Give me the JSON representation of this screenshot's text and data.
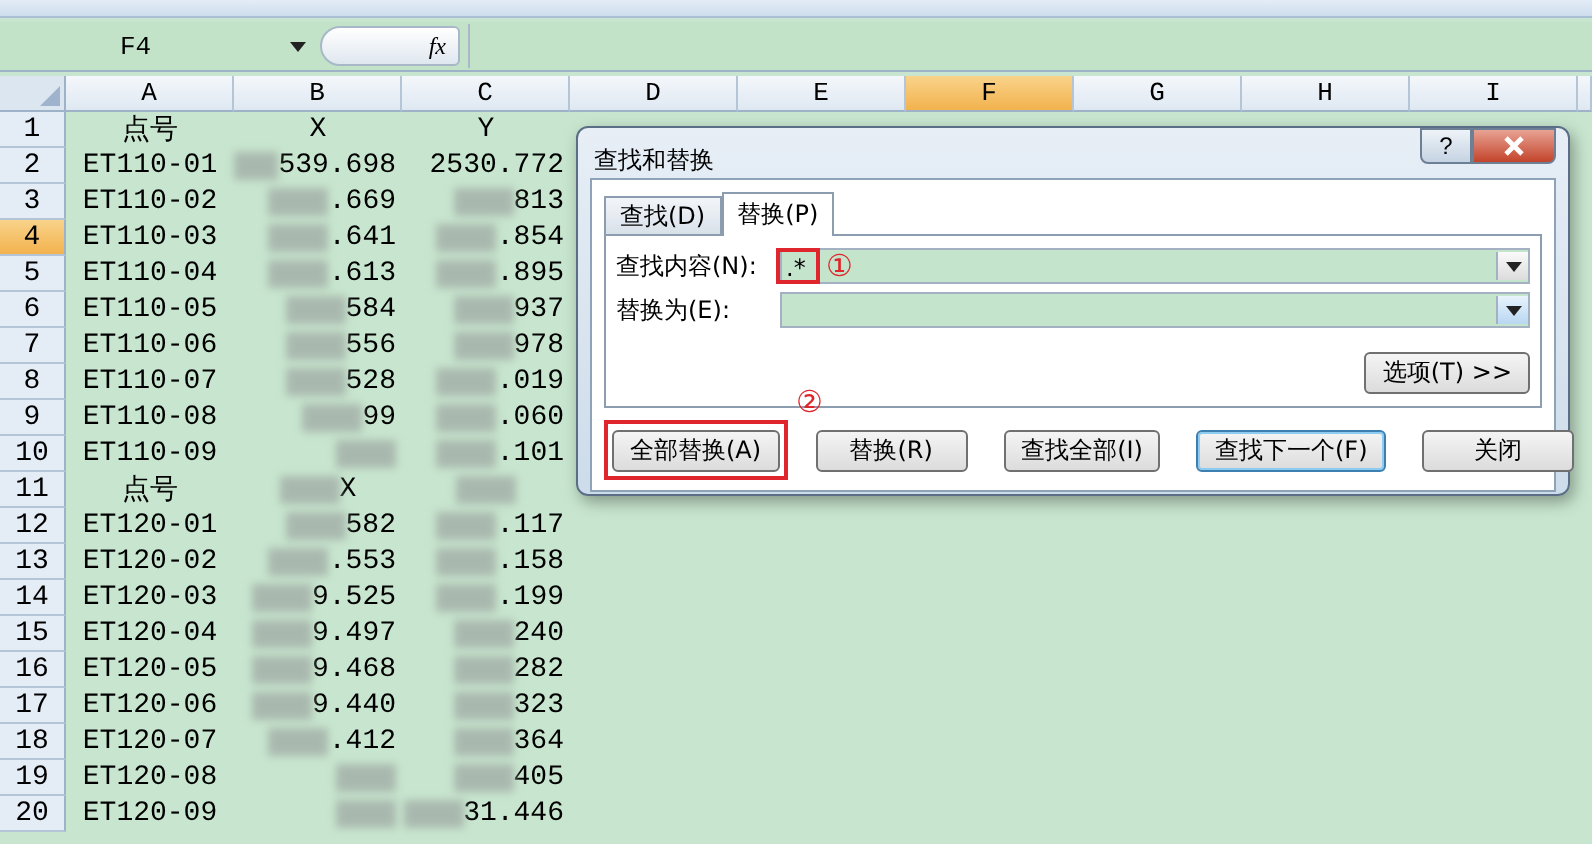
{
  "formula_bar": {
    "name_box": "F4",
    "fx": "fx"
  },
  "columns": [
    {
      "label": "A",
      "selected": false
    },
    {
      "label": "B",
      "selected": false
    },
    {
      "label": "C",
      "selected": false
    },
    {
      "label": "D",
      "selected": false
    },
    {
      "label": "E",
      "selected": false
    },
    {
      "label": "F",
      "selected": true
    },
    {
      "label": "G",
      "selected": false
    },
    {
      "label": "H",
      "selected": false
    },
    {
      "label": "I",
      "selected": false
    }
  ],
  "rows": [
    {
      "number": "1",
      "selected": false,
      "cells": [
        {
          "text": "点号",
          "blurred": false
        },
        {
          "text": "X",
          "blurred": false
        },
        {
          "text": "Y",
          "blurred": false
        }
      ]
    },
    {
      "number": "2",
      "selected": false,
      "cells": [
        {
          "text": "ET110-01",
          "blurred": false
        },
        {
          "text": "539.698",
          "blurred": true
        },
        {
          "text": "2530.772",
          "blurred": false
        }
      ]
    },
    {
      "number": "3",
      "selected": false,
      "cells": [
        {
          "text": "ET110-02",
          "blurred": false
        },
        {
          "text": ".669",
          "blurred": true
        },
        {
          "text": "813",
          "blurred": true
        }
      ]
    },
    {
      "number": "4",
      "selected": true,
      "cells": [
        {
          "text": "ET110-03",
          "blurred": false
        },
        {
          "text": ".641",
          "blurred": true
        },
        {
          "text": ".854",
          "blurred": true
        }
      ]
    },
    {
      "number": "5",
      "selected": false,
      "cells": [
        {
          "text": "ET110-04",
          "blurred": false
        },
        {
          "text": ".613",
          "blurred": true
        },
        {
          "text": ".895",
          "blurred": true
        }
      ]
    },
    {
      "number": "6",
      "selected": false,
      "cells": [
        {
          "text": "ET110-05",
          "blurred": false
        },
        {
          "text": "584",
          "blurred": true
        },
        {
          "text": "937",
          "blurred": true
        }
      ]
    },
    {
      "number": "7",
      "selected": false,
      "cells": [
        {
          "text": "ET110-06",
          "blurred": false
        },
        {
          "text": "556",
          "blurred": true
        },
        {
          "text": "978",
          "blurred": true
        }
      ]
    },
    {
      "number": "8",
      "selected": false,
      "cells": [
        {
          "text": "ET110-07",
          "blurred": false
        },
        {
          "text": "528",
          "blurred": true
        },
        {
          "text": ".019",
          "blurred": true
        }
      ]
    },
    {
      "number": "9",
      "selected": false,
      "cells": [
        {
          "text": "ET110-08",
          "blurred": false
        },
        {
          "text": "99",
          "blurred": true
        },
        {
          "text": ".060",
          "blurred": true
        }
      ]
    },
    {
      "number": "10",
      "selected": false,
      "cells": [
        {
          "text": "ET110-09",
          "blurred": false
        },
        {
          "blurred": true
        },
        {
          "text": ".101",
          "blurred": true
        }
      ]
    },
    {
      "number": "11",
      "selected": false,
      "cells": [
        {
          "text": "点号",
          "blurred": false
        },
        {
          "text": "X",
          "blurred": true
        },
        {
          "blurred": true
        }
      ]
    },
    {
      "number": "12",
      "selected": false,
      "cells": [
        {
          "text": "ET120-01",
          "blurred": false
        },
        {
          "text": "582",
          "blurred": true
        },
        {
          "text": ".117",
          "blurred": true
        }
      ]
    },
    {
      "number": "13",
      "selected": false,
      "cells": [
        {
          "text": "ET120-02",
          "blurred": false
        },
        {
          "text": ".553",
          "blurred": true
        },
        {
          "text": ".158",
          "blurred": true
        }
      ]
    },
    {
      "number": "14",
      "selected": false,
      "cells": [
        {
          "text": "ET120-03",
          "blurred": false
        },
        {
          "text": "9.525",
          "blurred": true
        },
        {
          "text": ".199",
          "blurred": true
        }
      ]
    },
    {
      "number": "15",
      "selected": false,
      "cells": [
        {
          "text": "ET120-04",
          "blurred": false
        },
        {
          "text": "9.497",
          "blurred": true
        },
        {
          "text": "240",
          "blurred": true
        }
      ]
    },
    {
      "number": "16",
      "selected": false,
      "cells": [
        {
          "text": "ET120-05",
          "blurred": false
        },
        {
          "text": "9.468",
          "blurred": true
        },
        {
          "text": "282",
          "blurred": true
        }
      ]
    },
    {
      "number": "17",
      "selected": false,
      "cells": [
        {
          "text": "ET120-06",
          "blurred": false
        },
        {
          "text": "9.440",
          "blurred": true
        },
        {
          "text": "323",
          "blurred": true
        }
      ]
    },
    {
      "number": "18",
      "selected": false,
      "cells": [
        {
          "text": "ET120-07",
          "blurred": false
        },
        {
          "text": ".412",
          "blurred": true
        },
        {
          "text": "364",
          "blurred": true
        }
      ]
    },
    {
      "number": "19",
      "selected": false,
      "cells": [
        {
          "text": "ET120-08",
          "blurred": false
        },
        {
          "blurred": true
        },
        {
          "text": "405",
          "blurred": true
        }
      ]
    },
    {
      "number": "20",
      "selected": false,
      "cells": [
        {
          "text": "ET120-09",
          "blurred": false
        },
        {
          "blurred": true
        },
        {
          "text": "31.446",
          "blurred": true
        }
      ]
    }
  ],
  "dialog": {
    "title": "查找和替换",
    "help": "?",
    "tabs": [
      {
        "label": "查找(D)",
        "selected": false
      },
      {
        "label": "替换(P)",
        "selected": true
      }
    ],
    "find": {
      "label": "查找内容(N):",
      "value": ".*",
      "highlighted": true,
      "marker": "①"
    },
    "replace": {
      "label": "替换为(E):",
      "highlighted": false
    },
    "options_button": "选项(T) >>",
    "buttons": [
      {
        "label": "全部替换(A)",
        "default": false,
        "highlighted": true,
        "marker": "②"
      },
      {
        "label": "替换(R)",
        "default": false,
        "highlighted": false
      },
      {
        "label": "查找全部(I)",
        "default": false,
        "highlighted": false
      },
      {
        "label": "查找下一个(F)",
        "default": true,
        "highlighted": false
      },
      {
        "label": "关闭",
        "default": false,
        "highlighted": false
      }
    ]
  }
}
